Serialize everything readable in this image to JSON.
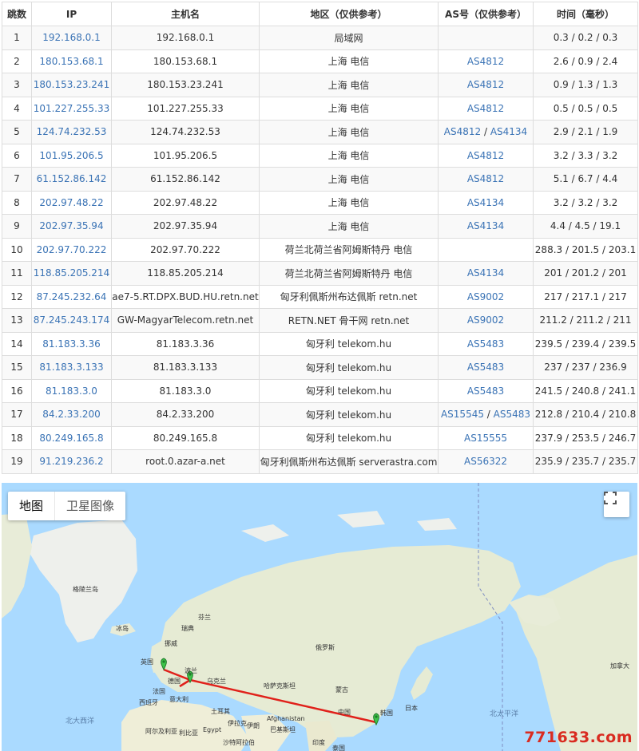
{
  "table": {
    "headers": [
      "跳数",
      "IP",
      "主机名",
      "地区（仅供参考）",
      "AS号（仅供参考）",
      "时间（毫秒）"
    ],
    "rows": [
      {
        "hop": "1",
        "ip": "192.168.0.1",
        "host": "192.168.0.1",
        "region": "局域网",
        "as1": "",
        "as2": "",
        "time": "0.3 / 0.2 / 0.3"
      },
      {
        "hop": "2",
        "ip": "180.153.68.1",
        "host": "180.153.68.1",
        "region": "上海 电信",
        "as1": "AS4812",
        "as2": "",
        "time": "2.6 / 0.9 / 2.4"
      },
      {
        "hop": "3",
        "ip": "180.153.23.241",
        "host": "180.153.23.241",
        "region": "上海 电信",
        "as1": "AS4812",
        "as2": "",
        "time": "0.9 / 1.3 / 1.3"
      },
      {
        "hop": "4",
        "ip": "101.227.255.33",
        "host": "101.227.255.33",
        "region": "上海 电信",
        "as1": "AS4812",
        "as2": "",
        "time": "0.5 / 0.5 / 0.5"
      },
      {
        "hop": "5",
        "ip": "124.74.232.53",
        "host": "124.74.232.53",
        "region": "上海 电信",
        "as1": "AS4812",
        "as2": "AS4134",
        "time": "2.9 / 2.1 / 1.9"
      },
      {
        "hop": "6",
        "ip": "101.95.206.5",
        "host": "101.95.206.5",
        "region": "上海 电信",
        "as1": "AS4812",
        "as2": "",
        "time": "3.2 / 3.3 / 3.2"
      },
      {
        "hop": "7",
        "ip": "61.152.86.142",
        "host": "61.152.86.142",
        "region": "上海 电信",
        "as1": "AS4812",
        "as2": "",
        "time": "5.1 / 6.7 / 4.4"
      },
      {
        "hop": "8",
        "ip": "202.97.48.22",
        "host": "202.97.48.22",
        "region": "上海 电信",
        "as1": "AS4134",
        "as2": "",
        "time": "3.2 / 3.2 / 3.2"
      },
      {
        "hop": "9",
        "ip": "202.97.35.94",
        "host": "202.97.35.94",
        "region": "上海 电信",
        "as1": "AS4134",
        "as2": "",
        "time": "4.4 / 4.5 / 19.1"
      },
      {
        "hop": "10",
        "ip": "202.97.70.222",
        "host": "202.97.70.222",
        "region": "荷兰北荷兰省阿姆斯特丹 电信",
        "as1": "",
        "as2": "",
        "time": "288.3 / 201.5 / 203.1"
      },
      {
        "hop": "11",
        "ip": "118.85.205.214",
        "host": "118.85.205.214",
        "region": "荷兰北荷兰省阿姆斯特丹 电信",
        "as1": "AS4134",
        "as2": "",
        "time": "201 / 201.2 / 201"
      },
      {
        "hop": "12",
        "ip": "87.245.232.64",
        "host": "ae7-5.RT.DPX.BUD.HU.retn.net",
        "region": "匈牙利佩斯州布达佩斯 retn.net",
        "as1": "AS9002",
        "as2": "",
        "time": "217 / 217.1 / 217"
      },
      {
        "hop": "13",
        "ip": "87.245.243.174",
        "host": "GW-MagyarTelecom.retn.net",
        "region": "RETN.NET 骨干网 retn.net",
        "as1": "AS9002",
        "as2": "",
        "time": "211.2 / 211.2 / 211"
      },
      {
        "hop": "14",
        "ip": "81.183.3.36",
        "host": "81.183.3.36",
        "region": "匈牙利 telekom.hu",
        "as1": "AS5483",
        "as2": "",
        "time": "239.5 / 239.4 / 239.5"
      },
      {
        "hop": "15",
        "ip": "81.183.3.133",
        "host": "81.183.3.133",
        "region": "匈牙利 telekom.hu",
        "as1": "AS5483",
        "as2": "",
        "time": "237 / 237 / 236.9"
      },
      {
        "hop": "16",
        "ip": "81.183.3.0",
        "host": "81.183.3.0",
        "region": "匈牙利 telekom.hu",
        "as1": "AS5483",
        "as2": "",
        "time": "241.5 / 240.8 / 241.1"
      },
      {
        "hop": "17",
        "ip": "84.2.33.200",
        "host": "84.2.33.200",
        "region": "匈牙利 telekom.hu",
        "as1": "AS15545",
        "as2": "AS5483",
        "time": "212.8 / 210.4 / 210.8"
      },
      {
        "hop": "18",
        "ip": "80.249.165.8",
        "host": "80.249.165.8",
        "region": "匈牙利 telekom.hu",
        "as1": "AS15555",
        "as2": "",
        "time": "237.9 / 253.5 / 246.7"
      },
      {
        "hop": "19",
        "ip": "91.219.236.2",
        "host": "root.0.azar-a.net",
        "region": "匈牙利佩斯州布达佩斯 serverastra.com",
        "as1": "AS56322",
        "as2": "",
        "time": "235.9 / 235.7 / 235.7"
      }
    ]
  },
  "map": {
    "tab_map": "地图",
    "tab_satellite": "卫星图像",
    "fullscreen_icon": "fullscreen-icon",
    "route_color": "#e0211b",
    "labels": {
      "greenland": "格陵兰岛",
      "iceland": "冰岛",
      "finland": "芬兰",
      "sweden": "瑞典",
      "norway": "挪威",
      "uk": "英国",
      "poland": "波兰",
      "germany": "德国",
      "ukraine": "乌克兰",
      "france": "法国",
      "spain": "西班牙",
      "italy": "意大利",
      "russia": "俄罗斯",
      "kazakhstan": "哈萨克斯坦",
      "mongolia": "蒙古",
      "china": "中国",
      "japan": "日本",
      "korea": "韩国",
      "afghanistan": "Afghanistan",
      "pakistan": "巴基斯坦",
      "iran": "伊朗",
      "iraq": "伊拉克",
      "turkey": "土耳其",
      "egypt": "Egypt",
      "algeria": "阿尔及利亚",
      "libya": "利比亚",
      "saudi": "沙特阿拉伯",
      "india": "印度",
      "thailand": "泰国",
      "canada": "加拿大",
      "ocean_atlantic": "北大西洋",
      "ocean_pacific": "北太平洋"
    }
  },
  "watermark": "771633.com"
}
